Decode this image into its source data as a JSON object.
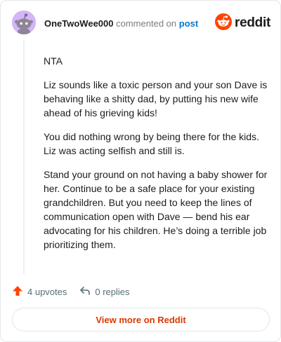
{
  "header": {
    "username": "OneTwoWee000",
    "verb": "commented on",
    "post_link": "post",
    "brand": "reddit"
  },
  "comment": {
    "paragraphs": [
      "NTA",
      "Liz sounds like a toxic person and your son Dave is behaving like a shitty dad, by putting his new wife ahead of his grieving kids!",
      "You did nothing wrong by being there for the kids. Liz was acting selfish and still is.",
      "Stand your ground on not having a baby shower for her. Continue to be a safe place for your existing grandchildren. But you need to keep the lines of communication open with Dave — bend his ear advocating for his children. He’s doing a terrible job prioritizing them."
    ]
  },
  "actions": {
    "upvotes_label": "4 upvotes",
    "replies_label": "0 replies"
  },
  "footer": {
    "view_more_label": "View more on Reddit"
  },
  "icons": {
    "avatar": "snoo-avatar-icon",
    "brand": "reddit-logo-icon",
    "upvote": "upvote-arrow-icon",
    "reply": "reply-arrow-icon"
  },
  "colors": {
    "avatar_bg": "#d4b5f5",
    "reddit_orange": "#ff4500",
    "link_blue": "#0079d3",
    "view_more_text": "#d93a00"
  }
}
